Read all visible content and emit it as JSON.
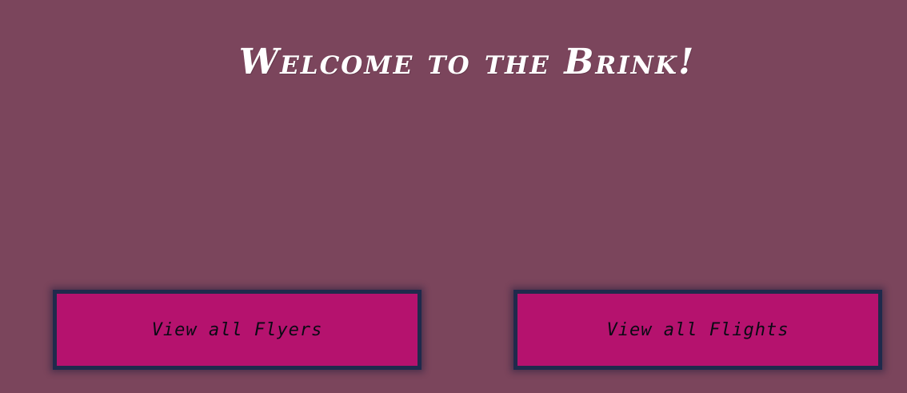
{
  "header": {
    "title": "Welcome to the Brink!"
  },
  "actions": {
    "view_flyers_label": "View all Flyers",
    "view_flights_label": "View all Flights"
  },
  "colors": {
    "background": "#7b455c",
    "button_fill": "#b5126e",
    "button_border": "#1f2a4c",
    "title_text": "#ffffff"
  }
}
